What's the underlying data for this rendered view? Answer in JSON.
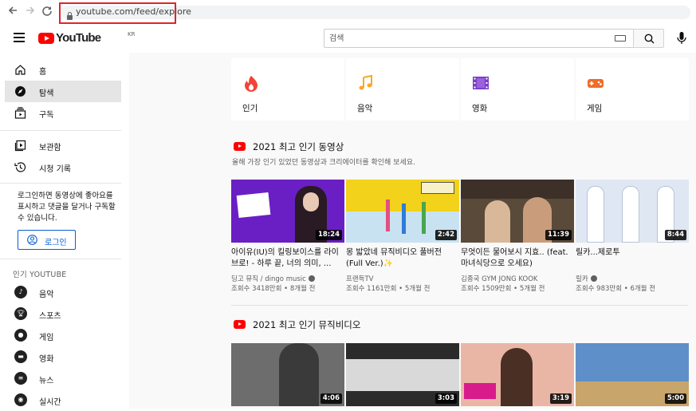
{
  "browser": {
    "url": "youtube.com/feed/explore",
    "icons": [
      "back-icon",
      "forward-icon",
      "reload-icon",
      "lock-icon"
    ]
  },
  "header": {
    "logo_text": "YouTube",
    "region": "KR",
    "search_placeholder": "검색"
  },
  "sidebar": {
    "main_items": [
      {
        "label": "홈",
        "icon": "home-icon"
      },
      {
        "label": "탐색",
        "icon": "compass-icon",
        "active": true
      },
      {
        "label": "구독",
        "icon": "subscriptions-icon"
      }
    ],
    "library_items": [
      {
        "label": "보관함",
        "icon": "library-icon"
      },
      {
        "label": "시청 기록",
        "icon": "history-icon"
      }
    ],
    "login_note": "로그인하면 동영상에 좋아요를 표시하고 댓글을 달거나 구독할 수 있습니다.",
    "login_button": "로그인",
    "popular_heading": "인기 YOUTUBE",
    "popular_items": [
      {
        "label": "음악",
        "icon": "music-icon"
      },
      {
        "label": "스포츠",
        "icon": "trophy-icon"
      },
      {
        "label": "게임",
        "icon": "gamepad-icon"
      },
      {
        "label": "영화",
        "icon": "movie-icon"
      },
      {
        "label": "뉴스",
        "icon": "news-icon"
      },
      {
        "label": "실시간",
        "icon": "live-icon"
      }
    ]
  },
  "categories": [
    {
      "label": "인기",
      "icon": "flame-icon",
      "color": "#f44336"
    },
    {
      "label": "음악",
      "icon": "music-note-icon",
      "color": "#f9a825"
    },
    {
      "label": "영화",
      "icon": "film-icon",
      "color": "#7b3fc4"
    },
    {
      "label": "게임",
      "icon": "gamepad-icon",
      "color": "#ef6c2a"
    }
  ],
  "section1": {
    "title": "2021 최고 인기 동영상",
    "subtitle": "올해 가장 인기 있었던 동영상과 크리에이터를 확인해 보세요.",
    "videos": [
      {
        "title": "아이유(IU)의 킬링보이스를 라이브로! - 하루 끝, 너의 의미, ...",
        "channel": "딩고 뮤직 / dingo music",
        "verified": true,
        "meta": "조회수 3418만회 • 8개월 전",
        "duration": "18:24",
        "bg": "#6a1fc4"
      },
      {
        "title": "몽 밟았네 뮤직비디오 풀버전 (Full Ver.)✨",
        "channel": "프랜득TV",
        "verified": false,
        "meta": "조회수 1161만회 • 5개월 전",
        "duration": "2:42",
        "bg": "#f2d21b"
      },
      {
        "title": "무엇이든 물어보시 지효.. (feat. 마녀식당으로 오세요)",
        "channel": "김종국 GYM JONG KOOK",
        "verified": false,
        "meta": "조회수 1509만회 • 5개월 전",
        "duration": "11:39",
        "bg": "#5a4a3a"
      },
      {
        "title": "릴카...제로투",
        "channel": "릴카",
        "verified": true,
        "meta": "조회수 983만회 • 6개월 전",
        "duration": "8:44",
        "bg": "#dfe7f3"
      }
    ]
  },
  "section2": {
    "title": "2021 최고 인기 뮤직비디오",
    "videos": [
      {
        "duration": "4:06",
        "bg": "#6d6d6d"
      },
      {
        "duration": "3:03",
        "bg": "#2b2b2b"
      },
      {
        "duration": "3:19",
        "bg": "#e9b6a6"
      },
      {
        "duration": "5:00",
        "bg": "#5f8fc8"
      }
    ]
  }
}
